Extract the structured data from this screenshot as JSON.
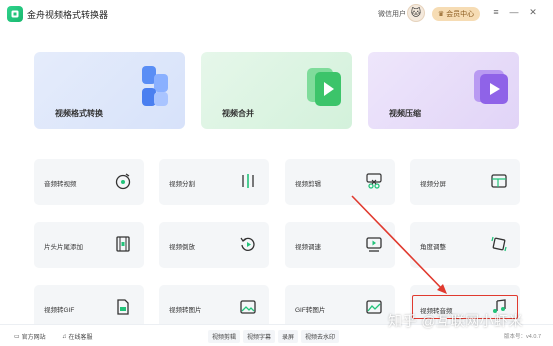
{
  "app": {
    "title": "金舟视频格式转换器"
  },
  "header": {
    "user_name": "微信用户",
    "vip_label": "会员中心"
  },
  "window_controls": {
    "menu": "≡",
    "minimize": "—",
    "close": "✕"
  },
  "big_cards": [
    {
      "label": "视频格式转换",
      "icon": "format-convert-icon",
      "color": "#4a7ff0"
    },
    {
      "label": "视频合并",
      "icon": "merge-play-icon",
      "color": "#3cc46a"
    },
    {
      "label": "视频压缩",
      "icon": "compress-play-icon",
      "color": "#8f63e8"
    }
  ],
  "tools": [
    {
      "label": "音频转视频",
      "icon": "audio-disc-icon"
    },
    {
      "label": "视频分割",
      "icon": "split-icon"
    },
    {
      "label": "视频剪辑",
      "icon": "scissors-icon"
    },
    {
      "label": "视频分屏",
      "icon": "split-screen-icon"
    },
    {
      "label": "片头片尾添加",
      "icon": "film-icon"
    },
    {
      "label": "视频倒放",
      "icon": "reverse-icon"
    },
    {
      "label": "视频调速",
      "icon": "speed-icon"
    },
    {
      "label": "角度调整",
      "icon": "rotate-icon"
    },
    {
      "label": "视频转GIF",
      "icon": "gif-icon"
    },
    {
      "label": "视频转图片",
      "icon": "image-icon"
    },
    {
      "label": "GIF转图片",
      "icon": "gif-image-icon"
    },
    {
      "label": "视频转音频",
      "icon": "music-note-icon"
    }
  ],
  "footer": {
    "website": "官方网站",
    "support": "在线客服",
    "tags": [
      "视频剪辑",
      "视频字幕",
      "录屏",
      "视频去水印"
    ],
    "version": "版本号：v4.0.7"
  },
  "watermark": "知乎 @互联网小虾米",
  "colors": {
    "accent_red": "#e03a2f",
    "brand_green": "#22c37a",
    "vip_gold": "#f6dcb4"
  }
}
